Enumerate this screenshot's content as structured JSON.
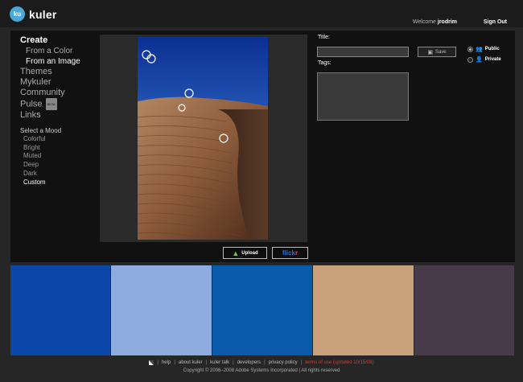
{
  "header": {
    "logo_text": "kuler",
    "logo_icon_text": "ku",
    "welcome_text": "Welcome",
    "username": "jrodrim",
    "sign_out": "Sign Out"
  },
  "nav": {
    "create": "Create",
    "from_color": "From a Color",
    "from_image": "From an Image",
    "themes": "Themes",
    "mykuler": "Mykuler",
    "community": "Community",
    "pulse": "Pulse",
    "pulse_badge": "BETA",
    "links": "Links"
  },
  "mood": {
    "title": "Select a Mood",
    "items": [
      "Colorful",
      "Bright",
      "Muted",
      "Deep",
      "Dark",
      "Custom"
    ],
    "selected": "Custom"
  },
  "buttons": {
    "upload": "Upload",
    "flickr_a": "flick",
    "flickr_b": "r"
  },
  "form": {
    "title_label": "Title:",
    "title_value": "",
    "tags_label": "Tags:",
    "save": "Save",
    "public": "Public",
    "private": "Private",
    "visibility": "Public"
  },
  "colors": {
    "accent": "#4aa9d6",
    "swatches": [
      "#0a47a8",
      "#8cace0",
      "#0a5aaa",
      "#c9a17a",
      "#473b4a"
    ]
  },
  "footer": {
    "links": [
      "help",
      "about kuler",
      "kuler talk",
      "developers",
      "privacy policy"
    ],
    "terms": "terms of use (updated 10/15/08)",
    "copyright": "Copyright © 2006–2008 Adobe Systems Incorporated | All rights reserved"
  }
}
